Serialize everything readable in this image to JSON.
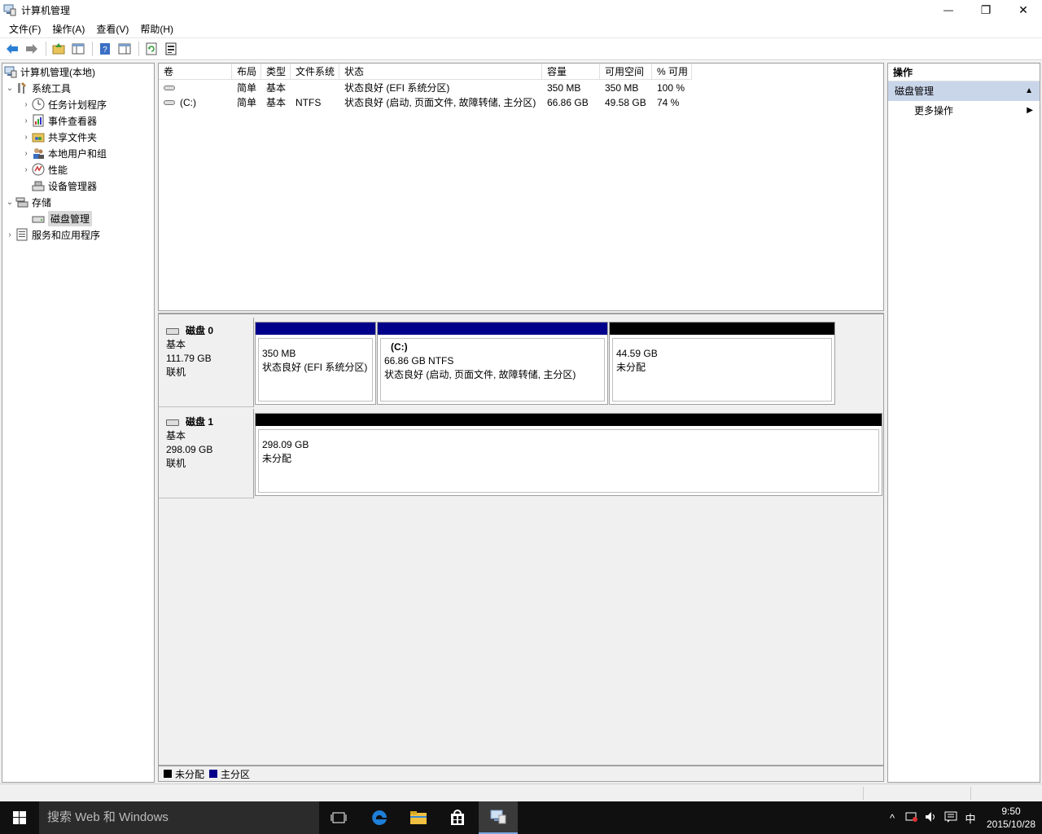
{
  "window": {
    "title": "计算机管理",
    "minimize": "—",
    "restore": "❐",
    "close": "✕"
  },
  "menu": [
    "文件(F)",
    "操作(A)",
    "查看(V)",
    "帮助(H)"
  ],
  "tree": {
    "root": "计算机管理(本地)",
    "system_tools": "系统工具",
    "task_scheduler": "任务计划程序",
    "event_viewer": "事件查看器",
    "shared_folders": "共享文件夹",
    "local_users": "本地用户和组",
    "performance": "性能",
    "device_manager": "设备管理器",
    "storage": "存储",
    "disk_management": "磁盘管理",
    "services_apps": "服务和应用程序"
  },
  "volumes": {
    "headers": [
      "卷",
      "布局",
      "类型",
      "文件系统",
      "状态",
      "容量",
      "可用空间",
      "% 可用"
    ],
    "rows": [
      {
        "volume": "",
        "layout": "简单",
        "type": "基本",
        "fs": "",
        "status": "状态良好 (EFI 系统分区)",
        "capacity": "350 MB",
        "free": "350 MB",
        "pct": "100 %"
      },
      {
        "volume": "(C:)",
        "layout": "简单",
        "type": "基本",
        "fs": "NTFS",
        "status": "状态良好 (启动, 页面文件, 故障转储, 主分区)",
        "capacity": "66.86 GB",
        "free": "49.58 GB",
        "pct": "74 %"
      }
    ]
  },
  "disks": [
    {
      "name": "磁盘 0",
      "type": "基本",
      "size": "111.79 GB",
      "state": "联机",
      "partitions": [
        {
          "title": "",
          "size": "350 MB",
          "status": "状态良好 (EFI 系统分区)",
          "kind": "primary"
        },
        {
          "title": "(C:)",
          "size": "66.86 GB NTFS",
          "status": "状态良好 (启动, 页面文件, 故障转储, 主分区)",
          "kind": "primary"
        },
        {
          "title": "",
          "size": "44.59 GB",
          "status": "未分配",
          "kind": "unallocated"
        }
      ]
    },
    {
      "name": "磁盘 1",
      "type": "基本",
      "size": "298.09 GB",
      "state": "联机",
      "partitions": [
        {
          "title": "",
          "size": "298.09 GB",
          "status": "未分配",
          "kind": "unallocated"
        }
      ]
    }
  ],
  "legend": {
    "unallocated": "未分配",
    "primary": "主分区"
  },
  "colors": {
    "primary": "#00008b",
    "unallocated": "#000000",
    "action_section": "#c9d6ea"
  },
  "actions": {
    "header": "操作",
    "section": "磁盘管理",
    "more": "更多操作"
  },
  "taskbar": {
    "search_placeholder": "搜索 Web 和 Windows",
    "ime": "中",
    "time": "9:50",
    "date": "2015/10/28"
  }
}
